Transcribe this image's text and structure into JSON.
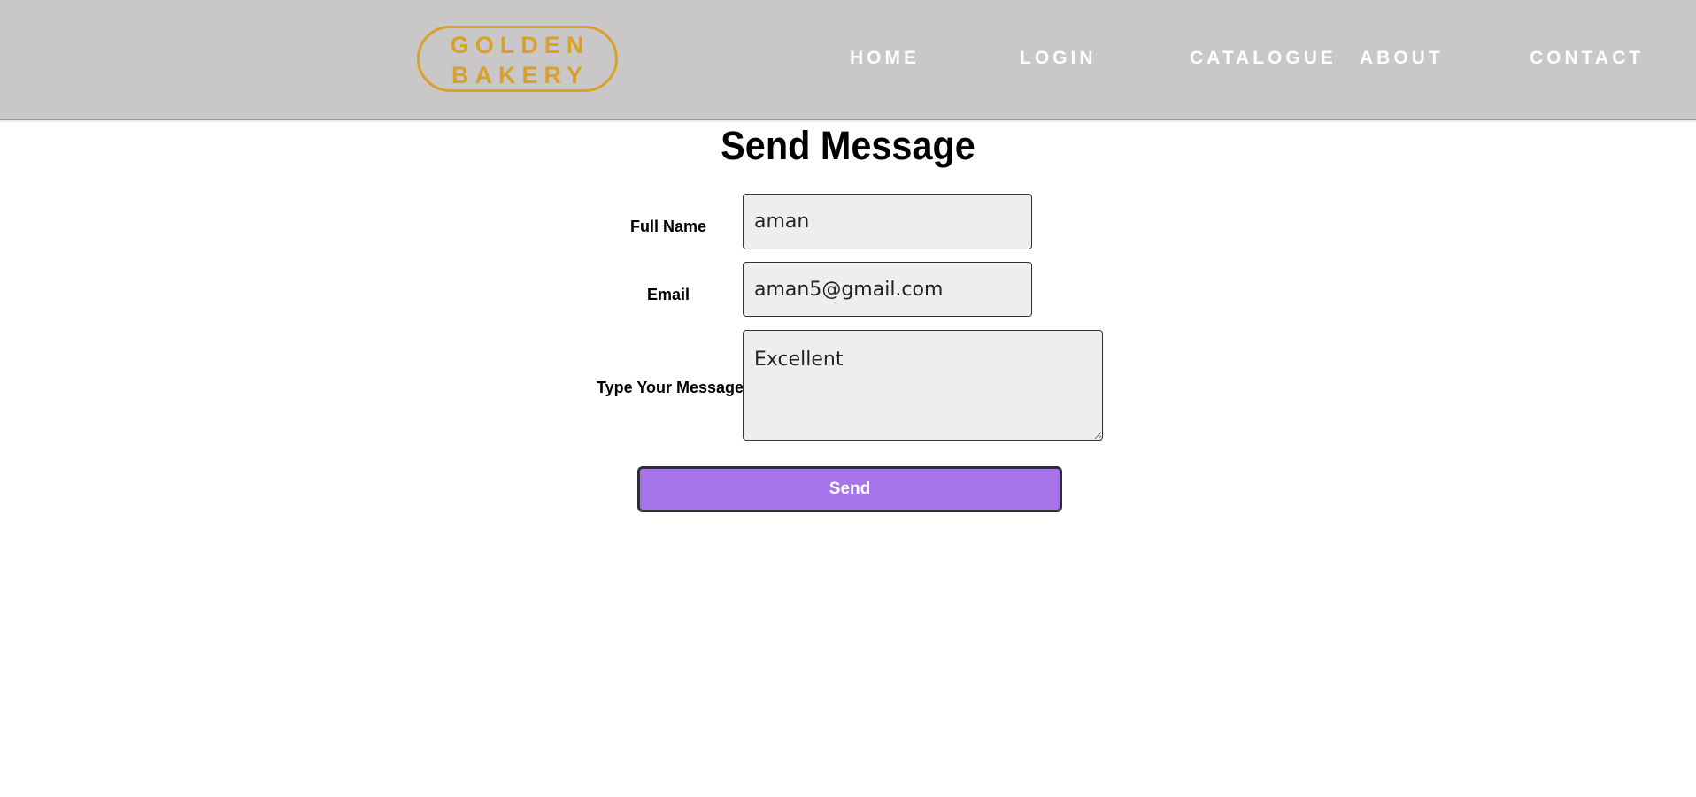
{
  "brand": {
    "line1": "GOLDEN",
    "line2": "BAKERY",
    "color": "#d9a12b"
  },
  "nav": {
    "home": "HOME",
    "login": "LOGIN",
    "catalogue": "CATALOGUE",
    "about": "ABOUT",
    "contact": "CONTACT"
  },
  "page": {
    "title": "Send Message"
  },
  "form": {
    "full_name": {
      "label": "Full Name",
      "value": "aman"
    },
    "email": {
      "label": "Email",
      "value": "aman5@gmail.com"
    },
    "message": {
      "label": "Type Your Message",
      "value": "Excellent"
    },
    "submit_label": "Send",
    "submit_color": "#a674e8"
  },
  "colors": {
    "navbar_bg": "#c9c7c8",
    "field_bg": "#eeeeee"
  }
}
